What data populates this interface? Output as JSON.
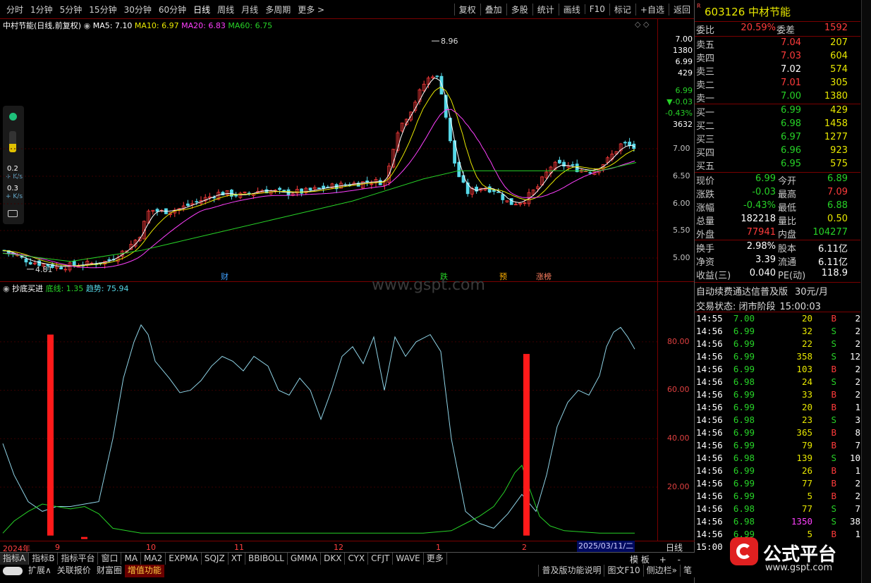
{
  "toolbar": {
    "periods": [
      "分时",
      "1分钟",
      "5分钟",
      "15分钟",
      "30分钟",
      "60分钟",
      "日线",
      "周线",
      "月线",
      "多周期",
      "更多 >"
    ],
    "tools": [
      "复权",
      "叠加",
      "多股",
      "统计",
      "画线",
      "F10",
      "标记",
      "+自选",
      "返回"
    ]
  },
  "main_chart": {
    "title": "中村节能(日线,前复权)",
    "ma5": "MA5: 7.10",
    "ma10": "MA10: 6.97",
    "ma20": "MA20: 6.83",
    "ma60": "MA60: 6.75",
    "high_label": "8.96",
    "low_label": "4.81",
    "markers": [
      "财",
      "跌",
      "预",
      "涨榜"
    ],
    "price_axis": [
      "7.00",
      "6.50",
      "6.00",
      "5.50",
      "5.00"
    ],
    "mini_quote": [
      "7.00",
      "1380",
      "6.99",
      "429",
      "6.99",
      "▼-0.03",
      "-0.43%",
      "3632"
    ],
    "side_widgets": {
      "speed1": "0.2",
      "speed1_unit": "K/s",
      "speed2": "0.3",
      "speed2_unit": "K/s"
    }
  },
  "indicator": {
    "name": "抄底买进",
    "bottom_line": "底线: 1.35",
    "trend": "趋势: 75.94",
    "axis": [
      "80.00",
      "60.00",
      "40.00",
      "20.00"
    ],
    "watermark": "www.gspt.com"
  },
  "x_axis": {
    "labels": [
      "2024年",
      "9",
      "10",
      "11",
      "12",
      "1",
      "2"
    ],
    "date_box": "2025/03/11/二",
    "period": "日线"
  },
  "bottom_tabs1": [
    "指标A",
    "指标B",
    "指标平台",
    "窗口",
    "MA",
    "MA2",
    "EXPMA",
    "SQJZ",
    "XT",
    "BBIBOLL",
    "GMMA",
    "DKX",
    "CYX",
    "CFJT",
    "WAVE",
    "更多"
  ],
  "bottom_tabs1_right": [
    "模",
    "板",
    "+",
    "-"
  ],
  "bottom_tabs2": [
    "扩展∧",
    "关联报价",
    "财富圈",
    "增值功能"
  ],
  "bottom_tabs2_right": [
    "普及版功能说明",
    "图文F10",
    "侧边栏»",
    "笔"
  ],
  "quote": {
    "code": "603126",
    "name": "中材节能",
    "weibi_label": "委比",
    "weibi": "20.59%",
    "weicha_label": "委差",
    "weicha": "1592",
    "asks": [
      {
        "label": "卖五",
        "price": "7.04",
        "vol": "207"
      },
      {
        "label": "卖四",
        "price": "7.03",
        "vol": "604"
      },
      {
        "label": "卖三",
        "price": "7.02",
        "vol": "574"
      },
      {
        "label": "卖二",
        "price": "7.01",
        "vol": "305"
      },
      {
        "label": "卖一",
        "price": "7.00",
        "vol": "1380"
      }
    ],
    "bids": [
      {
        "label": "买一",
        "price": "6.99",
        "vol": "429"
      },
      {
        "label": "买二",
        "price": "6.98",
        "vol": "1458"
      },
      {
        "label": "买三",
        "price": "6.97",
        "vol": "1277"
      },
      {
        "label": "买四",
        "price": "6.96",
        "vol": "923"
      },
      {
        "label": "买五",
        "price": "6.95",
        "vol": "575"
      }
    ],
    "stats": [
      {
        "l1": "现价",
        "v1": "6.99",
        "c1": "green",
        "l2": "今开",
        "v2": "6.89",
        "c2": "green"
      },
      {
        "l1": "涨跌",
        "v1": "-0.03",
        "c1": "green",
        "l2": "最高",
        "v2": "7.09",
        "c2": "red"
      },
      {
        "l1": "涨幅",
        "v1": "-0.43%",
        "c1": "green",
        "l2": "最低",
        "v2": "6.88",
        "c2": "green"
      },
      {
        "l1": "总量",
        "v1": "182218",
        "c1": "white",
        "l2": "量比",
        "v2": "0.50",
        "c2": "yellow"
      },
      {
        "l1": "外盘",
        "v1": "77941",
        "c1": "red",
        "l2": "内盘",
        "v2": "104277",
        "c2": "green"
      }
    ],
    "stats2": [
      {
        "l1": "换手",
        "v1": "2.98%",
        "l2": "股本",
        "v2": "6.11亿"
      },
      {
        "l1": "净资",
        "v1": "3.39",
        "l2": "流通",
        "v2": "6.11亿"
      },
      {
        "l1": "收益(三)",
        "v1": "0.040",
        "l2": "PE(动)",
        "v2": "118.9"
      }
    ],
    "promo": "自动续费通达信普及版",
    "promo_price": "30元/月",
    "status_label": "交易状态: 闭市阶段",
    "status_time": "15:00:03"
  },
  "ticks": [
    {
      "t": "14:55",
      "p": "7.00",
      "v": "20",
      "s": "B",
      "n": "2"
    },
    {
      "t": "14:56",
      "p": "6.99",
      "v": "32",
      "s": "S",
      "n": "2"
    },
    {
      "t": "14:56",
      "p": "6.99",
      "v": "22",
      "s": "S",
      "n": "2"
    },
    {
      "t": "14:56",
      "p": "6.99",
      "v": "358",
      "s": "S",
      "n": "12"
    },
    {
      "t": "14:56",
      "p": "6.99",
      "v": "103",
      "s": "B",
      "n": "2"
    },
    {
      "t": "14:56",
      "p": "6.98",
      "v": "24",
      "s": "S",
      "n": "2"
    },
    {
      "t": "14:56",
      "p": "6.99",
      "v": "33",
      "s": "B",
      "n": "2"
    },
    {
      "t": "14:56",
      "p": "6.99",
      "v": "20",
      "s": "B",
      "n": "1"
    },
    {
      "t": "14:56",
      "p": "6.98",
      "v": "23",
      "s": "S",
      "n": "3"
    },
    {
      "t": "14:56",
      "p": "6.99",
      "v": "365",
      "s": "B",
      "n": "8"
    },
    {
      "t": "14:56",
      "p": "6.99",
      "v": "79",
      "s": "B",
      "n": "7"
    },
    {
      "t": "14:56",
      "p": "6.98",
      "v": "139",
      "s": "S",
      "n": "10"
    },
    {
      "t": "14:56",
      "p": "6.99",
      "v": "26",
      "s": "B",
      "n": "1"
    },
    {
      "t": "14:56",
      "p": "6.99",
      "v": "77",
      "s": "B",
      "n": "2"
    },
    {
      "t": "14:56",
      "p": "6.99",
      "v": "5",
      "s": "B",
      "n": "2"
    },
    {
      "t": "14:56",
      "p": "6.98",
      "v": "77",
      "s": "S",
      "n": "7"
    },
    {
      "t": "14:56",
      "p": "6.98",
      "v": "1350",
      "s": "S",
      "n": "38"
    },
    {
      "t": "14:56",
      "p": "6.99",
      "v": "5",
      "s": "B",
      "n": "1"
    },
    {
      "t": "15:00",
      "p": "",
      "v": "",
      "s": "",
      "n": ""
    }
  ],
  "logo": {
    "text": "公式平台",
    "url_text": "www.gspt.com"
  },
  "colors": {
    "up": "#ff3b3b",
    "down": "#27d227",
    "ma5": "#ffffff",
    "ma10": "#e8e800",
    "ma20": "#ff40ff",
    "ma60": "#27d227",
    "trend": "#8fd3e6"
  }
}
